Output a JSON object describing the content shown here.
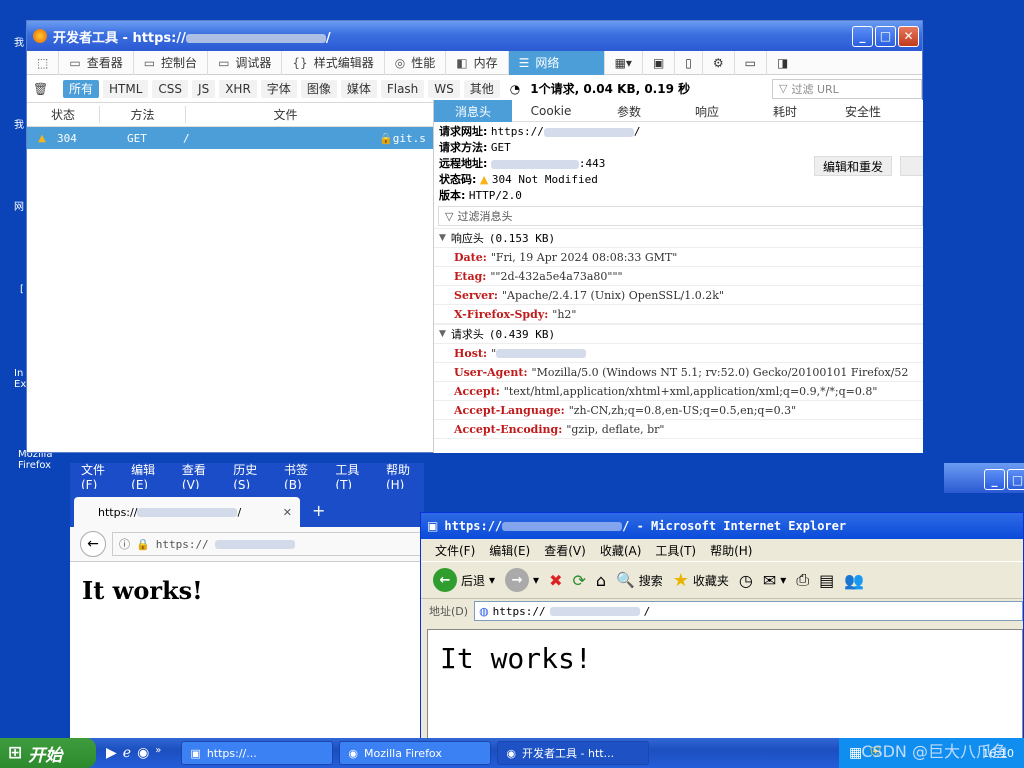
{
  "desktop": {
    "icons": [
      "我",
      "我",
      "网",
      "[",
      "In\nEx",
      "Mozilla\nFirefox"
    ]
  },
  "devtools": {
    "title": "开发者工具 - https://",
    "title_suffix": "/",
    "tabs": [
      "查看器",
      "控制台",
      "调试器",
      "样式编辑器",
      "性能",
      "内存",
      "网络"
    ],
    "filters": [
      "所有",
      "HTML",
      "CSS",
      "JS",
      "XHR",
      "字体",
      "图像",
      "媒体",
      "Flash",
      "WS",
      "其他"
    ],
    "summary": "1个请求, 0.04 KB, 0.19 秒",
    "url_filter_placeholder": "过滤 URL",
    "columns": [
      "状态",
      "方法",
      "文件"
    ],
    "request": {
      "status": "304",
      "method": "GET",
      "file": "/",
      "domain": "git.s"
    },
    "panel_tabs": [
      "消息头",
      "Cookie",
      "参数",
      "响应",
      "耗时",
      "安全性"
    ],
    "request_url_label": "请求网址:",
    "request_url": "https://",
    "request_url_suffix": "/",
    "method_label": "请求方法:",
    "method": "GET",
    "remote_label": "远程地址:",
    "remote": ":443",
    "status_label": "状态码:",
    "status": "304 Not Modified",
    "version_label": "版本:",
    "version": "HTTP/2.0",
    "edit_resend": "编辑和重发",
    "filter_headers_placeholder": "过滤消息头",
    "response_section": "响应头",
    "response_size": "(0.153 KB)",
    "response_headers": [
      {
        "k": "Date:",
        "v": "\"Fri, 19 Apr 2024 08:08:33 GMT\""
      },
      {
        "k": "Etag:",
        "v": "\"\"2d-432a5e4a73a80\"\"\""
      },
      {
        "k": "Server:",
        "v": "\"Apache/2.4.17 (Unix) OpenSSL/1.0.2k\""
      },
      {
        "k": "X-Firefox-Spdy:",
        "v": "\"h2\""
      }
    ],
    "request_section": "请求头",
    "request_size": "(0.439 KB)",
    "request_headers": [
      {
        "k": "Host:",
        "v": "\""
      },
      {
        "k": "User-Agent:",
        "v": "\"Mozilla/5.0 (Windows NT 5.1; rv:52.0) Gecko/20100101 Firefox/52"
      },
      {
        "k": "Accept:",
        "v": "\"text/html,application/xhtml+xml,application/xml;q=0.9,*/*;q=0.8\""
      },
      {
        "k": "Accept-Language:",
        "v": "\"zh-CN,zh;q=0.8,en-US;q=0.5,en;q=0.3\""
      },
      {
        "k": "Accept-Encoding:",
        "v": "\"gzip, deflate, br\""
      }
    ]
  },
  "firefox": {
    "menu": [
      "文件(F)",
      "编辑(E)",
      "查看(V)",
      "历史(S)",
      "书签(B)",
      "工具(T)",
      "帮助(H)"
    ],
    "tab_title": "https://",
    "tab_suffix": "/",
    "url": "https://",
    "content": "It works!"
  },
  "ie": {
    "title": "https://",
    "title_suffix": "/ - Microsoft Internet Explorer",
    "menu": [
      "文件(F)",
      "编辑(E)",
      "查看(V)",
      "收藏(A)",
      "工具(T)",
      "帮助(H)"
    ],
    "back": "后退",
    "search": "搜索",
    "favorites": "收藏夹",
    "address_label": "地址(D)",
    "address": "https://",
    "address_suffix": "/",
    "content": "It works!"
  },
  "taskbar": {
    "start": "开始",
    "tasks": [
      "https://...",
      "Mozilla Firefox",
      "开发者工具 - htt..."
    ],
    "clock": "16:10"
  },
  "watermark": "CSDN @巨大八爪鱼"
}
